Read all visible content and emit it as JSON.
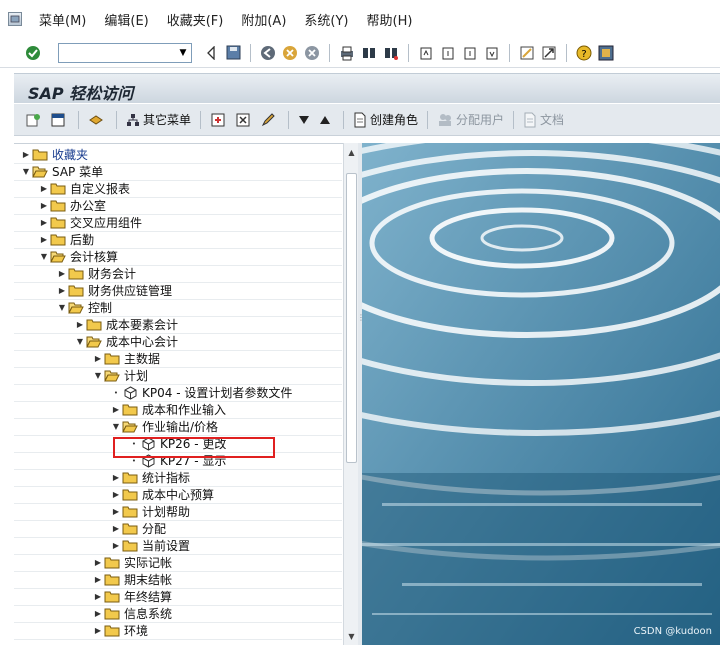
{
  "menubar": {
    "items": [
      "菜单(M)",
      "编辑(E)",
      "收藏夹(F)",
      "附加(A)",
      "系统(Y)",
      "帮助(H)"
    ]
  },
  "stdbar": {
    "command_value": ""
  },
  "titlebar": {
    "title": "SAP 轻松访问"
  },
  "appbar": {
    "other_menu": "其它菜单",
    "create_role": "创建角色",
    "assign_users": "分配用户",
    "documentation": "文档"
  },
  "tree": {
    "favorites": "收藏夹",
    "sap_menu": "SAP 菜单",
    "custom_reports": "自定义报表",
    "office": "办公室",
    "cross_app": "交叉应用组件",
    "logistics": "后勤",
    "accounting": "会计核算",
    "financial_accounting": "财务会计",
    "financial_supply_chain": "财务供应链管理",
    "controlling": "控制",
    "cost_element_accounting": "成本要素会计",
    "cost_center_accounting": "成本中心会计",
    "master_data": "主数据",
    "planning": "计划",
    "kp04": "KP04 - 设置计划者参数文件",
    "cost_activity_inputs": "成本和作业输入",
    "activity_output_price": "作业输出/价格",
    "kp26": "KP26 - 更改",
    "kp27": "KP27 - 显示",
    "statistical_key_figures": "统计指标",
    "cost_center_budget": "成本中心预算",
    "planning_aids": "计划帮助",
    "allocations": "分配",
    "current_settings": "当前设置",
    "actual_postings": "实际记帐",
    "period_end_closing": "期末结帐",
    "year_end_closing": "年终结算",
    "info_system": "信息系统",
    "environment": "环境"
  },
  "watermark": "CSDN @kudoon",
  "colors": {
    "folder": "#f2c94c",
    "highlight": "#e02020",
    "link": "#1a3d8f"
  }
}
